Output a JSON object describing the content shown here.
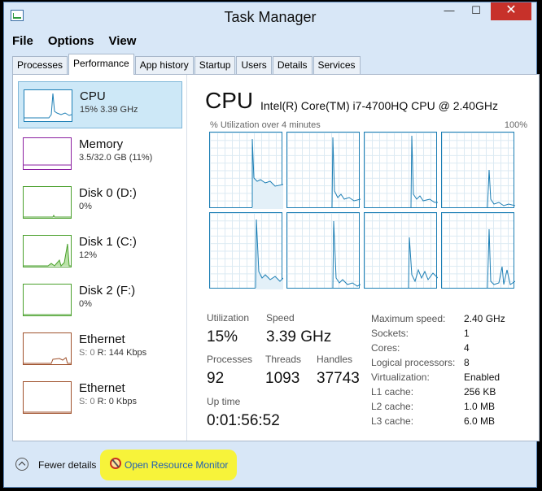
{
  "window": {
    "title": "Task Manager",
    "controls": {
      "minimize": "—",
      "maximize": "☐",
      "close": "✕"
    }
  },
  "menu": [
    "File",
    "Options",
    "View"
  ],
  "tabs": [
    "Processes",
    "Performance",
    "App history",
    "Startup",
    "Users",
    "Details",
    "Services"
  ],
  "active_tab": "Performance",
  "sidebar": [
    {
      "name": "CPU",
      "sub": "15% 3.39 GHz",
      "color": "#1d7fb5",
      "selected": true
    },
    {
      "name": "Memory",
      "sub": "3.5/32.0 GB (11%)",
      "color": "#8b1fa0"
    },
    {
      "name": "Disk 0 (D:)",
      "sub": "0%",
      "color": "#4aa02c"
    },
    {
      "name": "Disk 1 (C:)",
      "sub": "12%",
      "color": "#4aa02c"
    },
    {
      "name": "Disk 2 (F:)",
      "sub": "0%",
      "color": "#4aa02c"
    },
    {
      "name": "Ethernet",
      "sub_prefix": "S: 0",
      "sub": "R: 144 Kbps",
      "color": "#a0522d"
    },
    {
      "name": "Ethernet",
      "sub_prefix": "S: 0",
      "sub": "R: 0 Kbps",
      "color": "#a0522d"
    }
  ],
  "main": {
    "title": "CPU",
    "model": "Intel(R) Core(TM) i7-4700HQ CPU @ 2.40GHz",
    "util_label": "% Utilization over 4 minutes",
    "util_max": "100%"
  },
  "stats": {
    "utilization_label": "Utilization",
    "utilization": "15%",
    "speed_label": "Speed",
    "speed": "3.39 GHz",
    "processes_label": "Processes",
    "processes": "92",
    "threads_label": "Threads",
    "threads": "1093",
    "handles_label": "Handles",
    "handles": "37743",
    "uptime_label": "Up time",
    "uptime": "0:01:56:52"
  },
  "specs": [
    {
      "k": "Maximum speed:",
      "v": "2.40 GHz"
    },
    {
      "k": "Sockets:",
      "v": "1"
    },
    {
      "k": "Cores:",
      "v": "4"
    },
    {
      "k": "Logical processors:",
      "v": "8"
    },
    {
      "k": "Virtualization:",
      "v": "Enabled"
    },
    {
      "k": "L1 cache:",
      "v": "256 KB"
    },
    {
      "k": "L2 cache:",
      "v": "1.0 MB"
    },
    {
      "k": "L3 cache:",
      "v": "6.0 MB"
    }
  ],
  "footer": {
    "fewer_details": "Fewer details",
    "open_resource_monitor": "Open Resource Monitor"
  },
  "colors": {
    "cpu": "#1d7fb5",
    "highlight": "#f7f33a",
    "link": "#1f5fb6"
  }
}
